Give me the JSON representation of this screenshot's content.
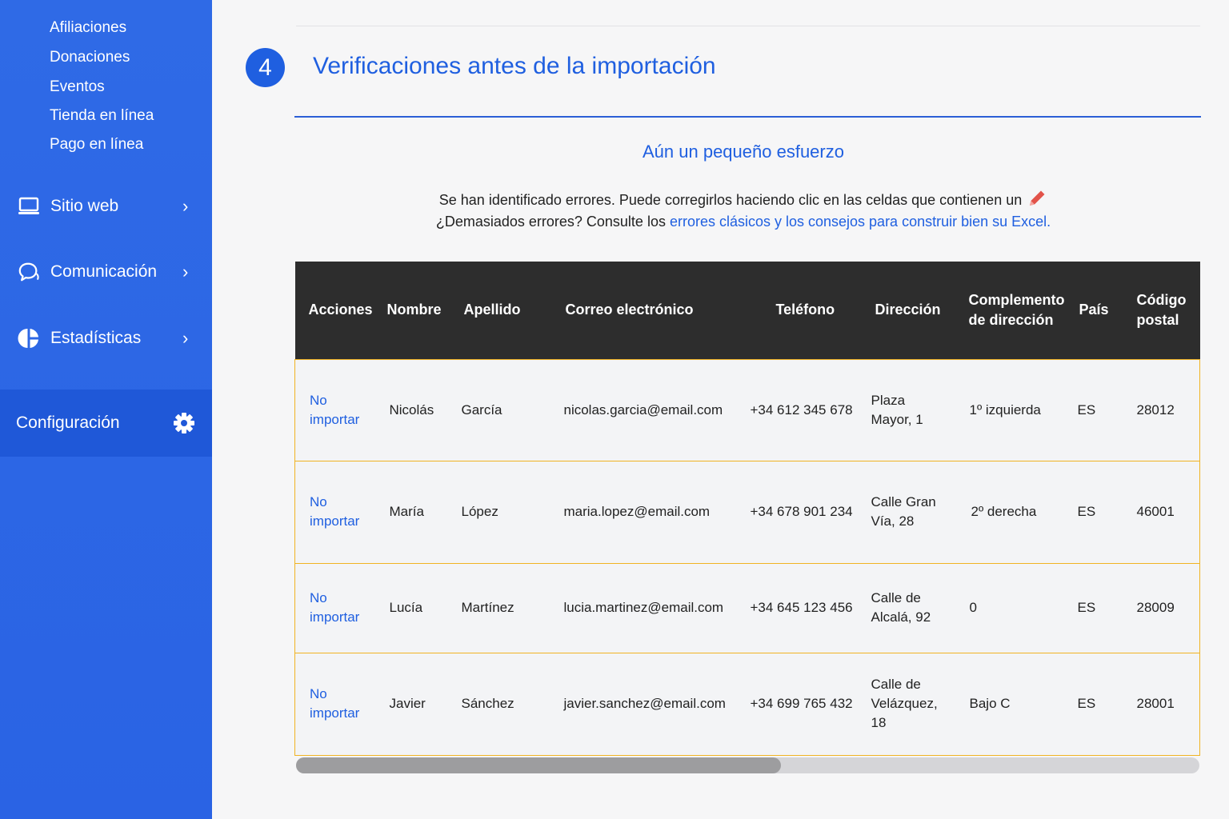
{
  "sidebar": {
    "sub_items": [
      "Afiliaciones",
      "Donaciones",
      "Eventos",
      "Tienda en línea",
      "Pago en línea"
    ],
    "nav": {
      "sitio_web": "Sitio web",
      "comunicacion": "Comunicación",
      "estadisticas": "Estadísticas"
    },
    "config_label": "Configuración"
  },
  "step": {
    "number": "4",
    "title": "Verificaciones antes de la importación"
  },
  "subtitle": "Aún un pequeño esfuerzo",
  "message": {
    "line1": "Se han identificado errores. Puede corregirlos haciendo clic en las celdas que contienen un",
    "line2_prefix": "¿Demasiados errores? Consulte los ",
    "line2_link": "errores clásicos y los consejos para construir bien su Excel."
  },
  "table": {
    "headers": {
      "acciones": "Acciones",
      "nombre": "Nombre",
      "apellido": "Apellido",
      "correo": "Correo electrónico",
      "telefono": "Teléfono",
      "direccion": "Dirección",
      "complemento": "Complemento de dirección",
      "pais": "País",
      "codigo": "Código postal"
    },
    "rows": [
      {
        "accion": "No importar",
        "nombre": "Nicolás",
        "apellido": "García",
        "correo": "nicolas.garcia@email.com",
        "telefono": "+34 612 345 678",
        "direccion": "Plaza Mayor, 1",
        "complemento": "1º izquierda",
        "pais": "ES",
        "codigo": "28012"
      },
      {
        "accion": "No importar",
        "nombre": "María",
        "apellido": "López",
        "correo": "maria.lopez@email.com",
        "telefono": "+34 678 901 234",
        "direccion": "Calle Gran Vía, 28",
        "complemento": "2º derecha",
        "pais": "ES",
        "codigo": "46001"
      },
      {
        "accion": "No importar",
        "nombre": "Lucía",
        "apellido": "Martínez",
        "correo": "lucia.martinez@email.com",
        "telefono": "+34 645 123 456",
        "direccion": "Calle de Alcalá, 92",
        "complemento": "0",
        "pais": "ES",
        "codigo": "28009"
      },
      {
        "accion": "No importar",
        "nombre": "Javier",
        "apellido": "Sánchez",
        "correo": "javier.sanchez@email.com",
        "telefono": "+34 699 765 432",
        "direccion": "Calle de Velázquez, 18",
        "complemento": "Bajo C",
        "pais": "ES",
        "codigo": "28001"
      }
    ]
  },
  "icons": {
    "sitio_web": "laptop-icon",
    "comunicacion": "chat-icon",
    "estadisticas": "pie-chart-icon",
    "config": "gear-icon",
    "edit": "pencil-icon"
  },
  "colors": {
    "sidebar": "#2f6ae6",
    "config_active": "#1f58d8",
    "accent": "#1f5fe0",
    "table_header": "#2d2d2d",
    "row_border": "#f0b323",
    "pencil": "#e2534a"
  }
}
